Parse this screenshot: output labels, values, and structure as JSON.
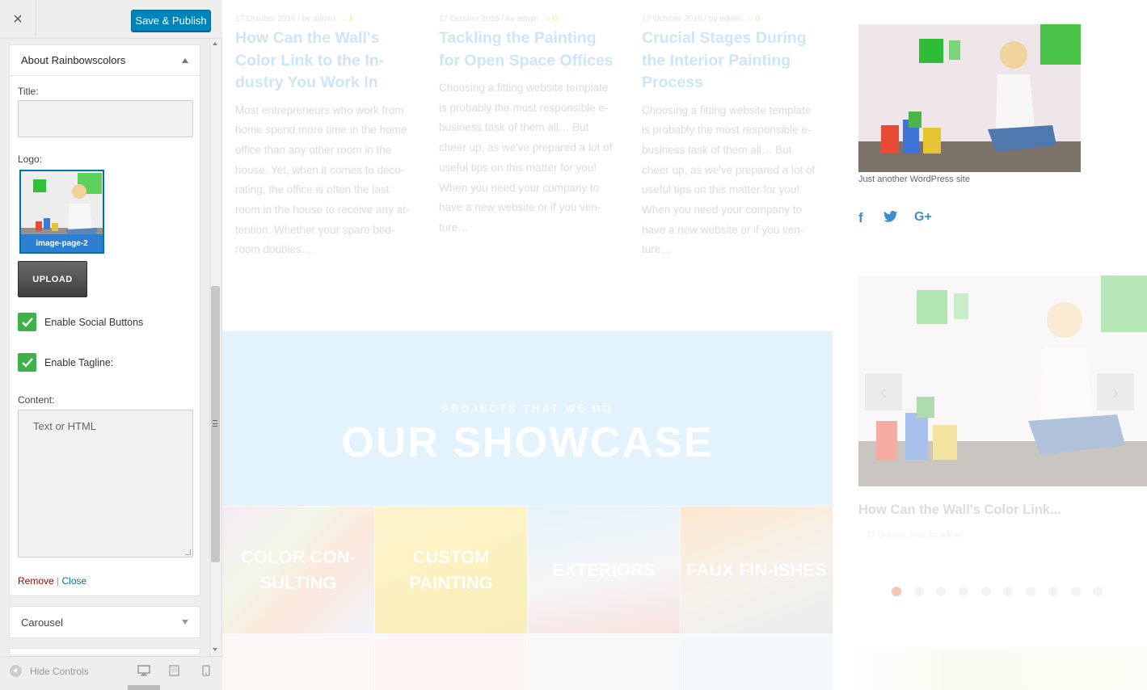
{
  "customizer": {
    "close_label": "×",
    "publish_label": "Save & Publish",
    "widget": {
      "title": "About Rainbowscolors",
      "title_label": "Title:",
      "title_value": "",
      "logo_label": "Logo:",
      "logo_caption": "image-page-2",
      "upload_label": "UPLOAD",
      "enable_social_label": "Enable Social Buttons",
      "enable_social_checked": true,
      "enable_tagline_label": "Enable Tagline:",
      "enable_tagline_checked": true,
      "content_label": "Content:",
      "content_placeholder": "Text or HTML",
      "remove_label": "Remove",
      "separator": "|",
      "close_link_label": "Close"
    },
    "next_widget_title": "Carousel",
    "footer": {
      "hide_controls_label": "Hide Controls",
      "devices": [
        "desktop-icon",
        "tablet-icon",
        "mobile-icon"
      ]
    }
  },
  "preview": {
    "posts": [
      {
        "meta": "17 October 2016 / by admin",
        "comments": "1",
        "title": "How Can the Wall's Color Link to the In-dustry You Work In",
        "excerpt": "Most entrepreneurs who work from home spend more time in the home office than any other room in the house. Yet, when it comes to deco-rating, the office is often the last room in the house to receive any at-tention. Whether your spare bed-room doubles…"
      },
      {
        "meta": "17 October 2016 / by admin",
        "comments": "0",
        "title": "Tackling the Painting for Open Space Offices",
        "excerpt": "Choosing a fitting website template is probably the most responsible e-business task of them all… But cheer up, as we've prepared a lot of useful tips on this matter for you! When you need your company to have a new website or if you ven-ture…"
      },
      {
        "meta": "17 October 2016 / by admin",
        "comments": "0",
        "title": "Crucial Stages During the Interior Painting Process",
        "excerpt": "Choosing a fitting website template is probably the most responsible e-business task of them all… But cheer up, as we've prepared a lot of useful tips on this matter for you! When you need your company to have a new website or if you ven-ture…"
      }
    ],
    "showcase": {
      "subtitle": "PROJECTS THAT WE DO",
      "title": "OUR SHOWCASE"
    },
    "tiles": [
      "COLOR CON-SULTING",
      "CUSTOM PAINTING",
      "EXTERIORS",
      "FAUX FIN-ISHES"
    ],
    "sidebar": {
      "tagline": "Just another WordPress site",
      "social": [
        "facebook-icon",
        "twitter-icon",
        "google-plus-icon"
      ],
      "carousel_title": "How Can the Wall's Color Link...",
      "carousel_meta": "17 October 2016    by admin",
      "carousel_dots": 10,
      "carousel_active_dot": 0
    },
    "colors": {
      "accent": "#0085ba",
      "checkbox": "#3eb249",
      "post_title": "#cde6f7",
      "showcase_bg": "#e3f3fd",
      "social": "#3a8fd1"
    }
  }
}
